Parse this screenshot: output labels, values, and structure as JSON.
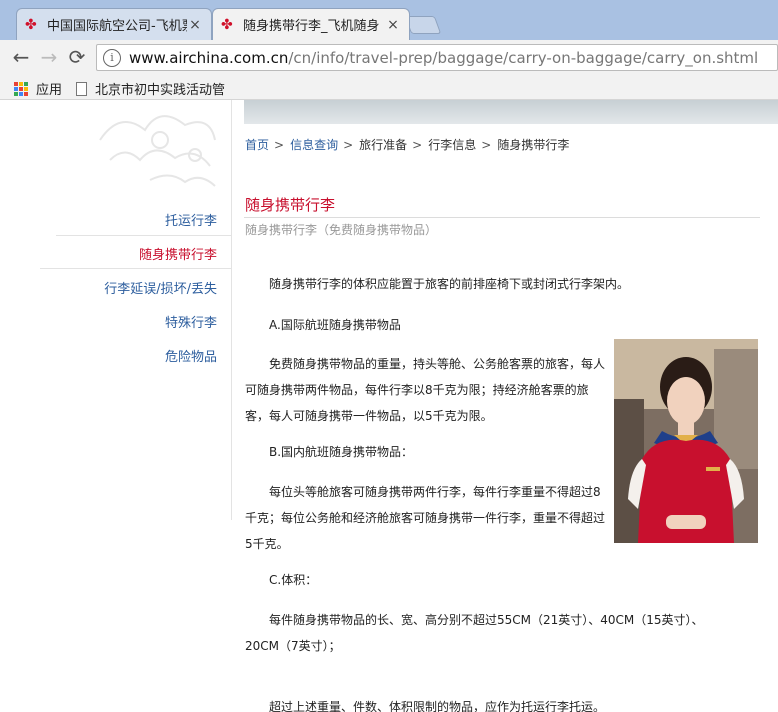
{
  "browser": {
    "tabs": [
      {
        "label": "中国国际航空公司-飞机票",
        "close": "×"
      },
      {
        "label": "随身携带行李_飞机随身",
        "close": "×"
      }
    ],
    "address": {
      "host": "www.airchina.com.cn",
      "path": "/cn/info/travel-prep/baggage/carry-on-baggage/carry_on.shtml"
    },
    "nav_icons": {
      "back": "←",
      "forward": "→",
      "reload": "⟳",
      "info": "i"
    },
    "bookmarks": [
      {
        "label": "应用",
        "icon": "apps-grid-icon"
      },
      {
        "label": "北京市初中实践活动管",
        "icon": "page-icon"
      }
    ],
    "accent_color": "#d0112b"
  },
  "sidebar": {
    "items": [
      {
        "label": "托运行李",
        "active": false
      },
      {
        "label": "随身携带行李",
        "active": true
      },
      {
        "label": "行李延误/损坏/丢失",
        "active": false
      },
      {
        "label": "特殊行李",
        "active": false
      },
      {
        "label": "危险物品",
        "active": false
      }
    ]
  },
  "breadcrumb": {
    "items": [
      {
        "label": "首页",
        "link": true
      },
      {
        "label": "信息查询",
        "link": true
      },
      {
        "label": "旅行准备",
        "link": false
      },
      {
        "label": "行李信息",
        "link": false
      },
      {
        "label": "随身携带行李",
        "link": false
      }
    ],
    "separator": ">"
  },
  "content": {
    "title": "随身携带行李",
    "subtitle": "随身携带行李（免费随身携带物品）",
    "paragraphs": [
      "随身携带行李的体积应能置于旅客的前排座椅下或封闭式行李架内。",
      "A.国际航班随身携带物品",
      "免费随身携带物品的重量，持头等舱、公务舱客票的旅客，每人可随身携带两件物品，每件行李以8千克为限；持经济舱客票的旅客，每人可随身携带一件物品，以5千克为限。",
      "B.国内航班随身携带物品：",
      "每位头等舱旅客可随身携带两件行李，每件行李重量不得超过8千克；每位公务舱和经济舱旅客可随身携带一件行李，重量不得超过5千克。",
      "C.体积：",
      "每件随身携带物品的长、宽、高分别不超过55CM（21英寸）、40CM（15英寸）、20CM（7英寸）；",
      "超过上述重量、件数、体积限制的物品，应作为托运行李托运。"
    ]
  },
  "colors": {
    "link": "#2d5e9e",
    "active": "#c8102e",
    "muted": "#999999"
  }
}
